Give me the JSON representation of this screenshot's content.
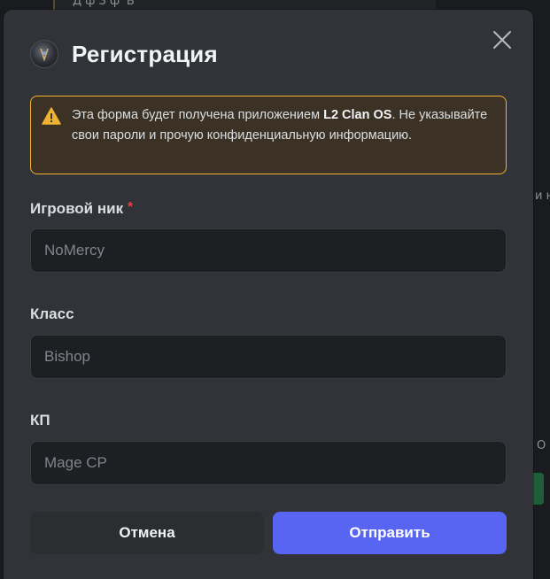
{
  "background": {
    "fragment_top": "Д                  ф                   З                     ф                 'В",
    "fragment_right": "и н",
    "fragment_right_2": "О"
  },
  "modal": {
    "title": "Регистрация",
    "app_icon": "clan-logo-icon",
    "close_icon": "close-icon",
    "warning": {
      "icon": "warning-triangle-icon",
      "text_before": "Эта форма будет получена приложением ",
      "app_name": "L2 Clan OS",
      "text_after": ". Не указывайте свои пароли и прочую конфиденциальную информацию.",
      "border_color": "#f0b232"
    },
    "fields": [
      {
        "label": "Игровой ник",
        "required_mark": "*",
        "placeholder": "NoMercy",
        "value": ""
      },
      {
        "label": "Класс",
        "placeholder": "Bishop",
        "value": ""
      },
      {
        "label": "КП",
        "placeholder": "Mage CP",
        "value": ""
      }
    ],
    "buttons": {
      "cancel": "Отмена",
      "submit": "Отправить"
    }
  },
  "colors": {
    "modal_bg": "#313338",
    "input_bg": "#1e1f22",
    "accent": "#5865f2",
    "required": "#f23f43"
  }
}
